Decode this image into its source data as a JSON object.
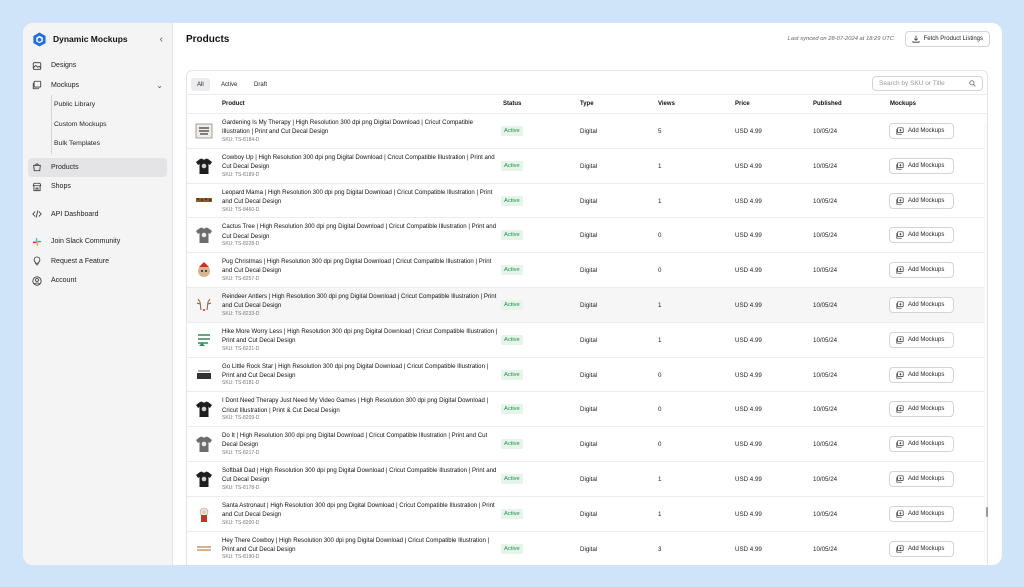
{
  "sidebar": {
    "brand": "Dynamic Mockups",
    "items": [
      {
        "label": "Designs"
      },
      {
        "label": "Mockups"
      },
      {
        "label": "Public Library"
      },
      {
        "label": "Custom Mockups"
      },
      {
        "label": "Bulk Templates"
      },
      {
        "label": "Products"
      },
      {
        "label": "Shops"
      },
      {
        "label": "API Dashboard"
      },
      {
        "label": "Join Slack Community"
      },
      {
        "label": "Request a Feature"
      },
      {
        "label": "Account"
      }
    ]
  },
  "header": {
    "title": "Products",
    "sync_text": "Last synced on 28-07-2024 at 18:29 UTC",
    "fetch_label": "Fetch Product Listings"
  },
  "tabs": [
    {
      "label": "All"
    },
    {
      "label": "Active"
    },
    {
      "label": "Draft"
    }
  ],
  "search": {
    "placeholder": "Search by SKU or Title"
  },
  "columns": [
    "Product",
    "Status",
    "Type",
    "Views",
    "Price",
    "Published",
    "Mockups"
  ],
  "rows": [
    {
      "title": "Gardening Is My Therapy | High Resolution 300 dpi png Digital Download | Cricut Compatible Illustration | Print and Cut Decal Design",
      "sku": "SKU: TS-8184-D",
      "status": "Active",
      "type": "Digital",
      "views": "5",
      "price": "USD 4.99",
      "published": "10/05/24",
      "action": "Add Mockups"
    },
    {
      "title": "Cowboy Up | High Resolution 300 dpi png Digital Download | Cricut Compatible Illustration | Print and Cut Decal Design",
      "sku": "SKU: TS-8189-D",
      "status": "Active",
      "type": "Digital",
      "views": "1",
      "price": "USD 4.99",
      "published": "10/05/24",
      "action": "Add Mockups"
    },
    {
      "title": "Leopard Mama | High Resolution 300 dpi png Digital Download | Cricut Compatible Illustration | Print and Cut Decal Design",
      "sku": "SKU: TS-8460-D",
      "status": "Active",
      "type": "Digital",
      "views": "1",
      "price": "USD 4.99",
      "published": "10/05/24",
      "action": "Add Mockups"
    },
    {
      "title": "Cactus Tree | High Resolution 300 dpi png Digital Download | Cricut Compatible Illustration | Print and Cut Decal Design",
      "sku": "SKU: TS-8228-D",
      "status": "Active",
      "type": "Digital",
      "views": "0",
      "price": "USD 4.99",
      "published": "10/05/24",
      "action": "Add Mockups"
    },
    {
      "title": "Pug Christmas | High Resolution 300 dpi png Digital Download | Cricut Compatible Illustration | Print and Cut Decal Design",
      "sku": "SKU: TS-8257-D",
      "status": "Active",
      "type": "Digital",
      "views": "0",
      "price": "USD 4.99",
      "published": "10/05/24",
      "action": "Add Mockups"
    },
    {
      "title": "Reindeer Antlers | High Resolution 300 dpi png Digital Download | Cricut Compatible Illustration | Print and Cut Decal Design",
      "sku": "SKU: TS-8233-D",
      "status": "Active",
      "type": "Digital",
      "views": "1",
      "price": "USD 4.99",
      "published": "10/05/24",
      "action": "Add Mockups"
    },
    {
      "title": "Hike More Worry Less | High Resolution 300 dpi png Digital Download | Cricut Compatible Illustration | Print and Cut Decal Design",
      "sku": "SKU: TS-8221-D",
      "status": "Active",
      "type": "Digital",
      "views": "1",
      "price": "USD 4.99",
      "published": "10/05/24",
      "action": "Add Mockups"
    },
    {
      "title": "Go Little Rock Star | High Resolution 300 dpi png Digital Download | Cricut Compatible Illustration | Print and Cut Decal Design",
      "sku": "SKU: TS-8181-D",
      "status": "Active",
      "type": "Digital",
      "views": "0",
      "price": "USD 4.99",
      "published": "10/05/24",
      "action": "Add Mockups"
    },
    {
      "title": "I Dont Need Therapy Just Need My Video Games | High Resolution 300 dpi png Digital Download | Cricut Illustration | Print & Cut Decal Design",
      "sku": "SKU: TS-8209-D",
      "status": "Active",
      "type": "Digital",
      "views": "0",
      "price": "USD 4.99",
      "published": "10/05/24",
      "action": "Add Mockups"
    },
    {
      "title": "Do It | High Resolution 300 dpi png Digital Download | Cricut Compatible Illustration | Print and Cut Decal Design",
      "sku": "SKU: TS-8217-D",
      "status": "Active",
      "type": "Digital",
      "views": "0",
      "price": "USD 4.99",
      "published": "10/05/24",
      "action": "Add Mockups"
    },
    {
      "title": "Softball Dad | High Resolution 300 dpi png Digital Download | Cricut Compatible Illustration | Print and Cut Decal Design",
      "sku": "SKU: TS-8178-D",
      "status": "Active",
      "type": "Digital",
      "views": "1",
      "price": "USD 4.99",
      "published": "10/05/24",
      "action": "Add Mockups"
    },
    {
      "title": "Santa Astronaut | High Resolution 300 dpi png Digital Download | Cricut Compatible Illustration | Print and Cut Decal Design",
      "sku": "SKU: TS-8200-D",
      "status": "Active",
      "type": "Digital",
      "views": "1",
      "price": "USD 4.99",
      "published": "10/05/24",
      "action": "Add Mockups"
    },
    {
      "title": "Hey There Cowboy | High Resolution 300 dpi png Digital Download | Cricut Compatible Illustration | Print and Cut Decal Design",
      "sku": "SKU: TS-8190-D",
      "status": "Active",
      "type": "Digital",
      "views": "3",
      "price": "USD 4.99",
      "published": "10/05/24",
      "action": "Add Mockups"
    }
  ],
  "thumbnails": [
    "framed-print",
    "black-tshirt",
    "leopard-text",
    "gray-tshirt",
    "pug-graphic",
    "antlers-graphic",
    "green-text",
    "rockstar-graphic",
    "black-tshirt",
    "gray-tshirt",
    "black-tshirt",
    "santa-graphic",
    "cowboy-text"
  ],
  "colors": {
    "accent": "#1f6fe0",
    "status_active_bg": "#e6f4ea",
    "status_active_text": "#1f9254",
    "background": "#cfe4f9"
  }
}
